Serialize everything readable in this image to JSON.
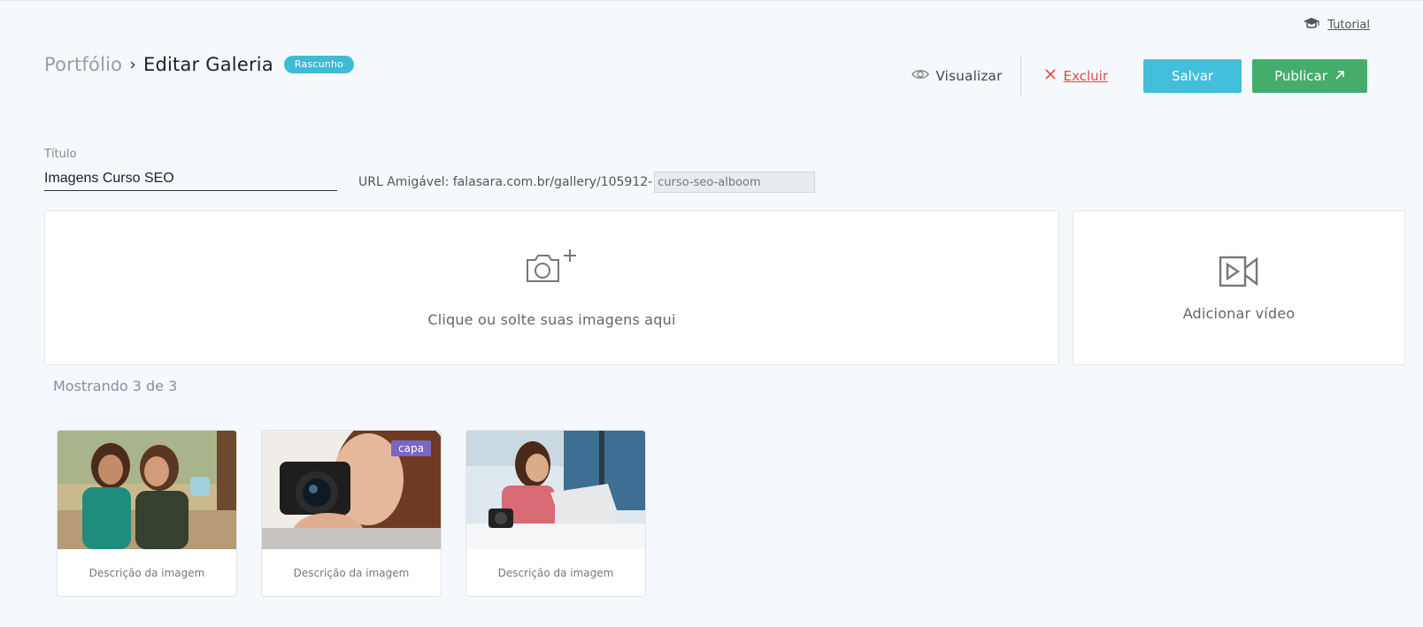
{
  "tutorial": {
    "label": "Tutorial",
    "icon": "graduation-cap-icon"
  },
  "header": {
    "breadcrumb_root": "Portfólio",
    "breadcrumb_separator": "›",
    "breadcrumb_current": "Editar Galeria",
    "status_badge": "Rascunho",
    "status_color": "#3fbbd4"
  },
  "actions": {
    "view_label": "Visualizar",
    "delete_label": "Excluir",
    "save_label": "Salvar",
    "publish_label": "Publicar",
    "save_color": "#43bedb",
    "publish_color": "#45ac6c",
    "delete_color": "#e04a4a"
  },
  "form": {
    "title_label": "Título",
    "title_value": "Imagens Curso SEO",
    "url_label": "URL Amigável: falasara.com.br/gallery/105912-",
    "slug_value": "curso-seo-alboom"
  },
  "dropzones": {
    "images_text": "Clique ou solte suas imagens aqui",
    "video_text": "Adicionar vídeo"
  },
  "gallery": {
    "count_text": "Mostrando 3 de 3",
    "items": [
      {
        "description_placeholder": "Descrição da imagem",
        "is_cover": false,
        "cover_label": ""
      },
      {
        "description_placeholder": "Descrição da imagem",
        "is_cover": true,
        "cover_label": "capa"
      },
      {
        "description_placeholder": "Descrição da imagem",
        "is_cover": false,
        "cover_label": ""
      }
    ],
    "cover_color": "#7b66c4"
  }
}
